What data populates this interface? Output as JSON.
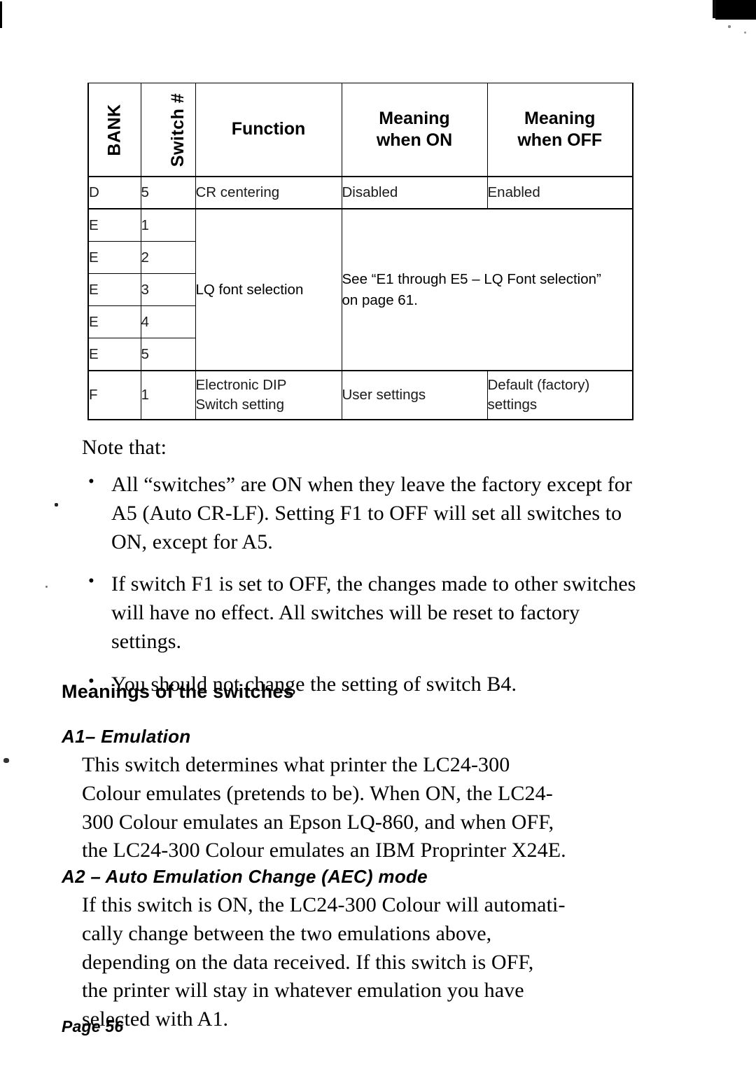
{
  "page": {
    "footer_label": "Page 56"
  },
  "table": {
    "headers": {
      "bank": "BANK",
      "switch_num": "Switch #",
      "function": "Function",
      "meaning_on_line1": "Meaning",
      "meaning_on_line2": "when ON",
      "meaning_off_line1": "Meaning",
      "meaning_off_line2": "when OFF"
    },
    "rows": [
      {
        "bank": "D",
        "switch": "5",
        "function": "CR centering",
        "on": "Disabled",
        "off": "Enabled"
      },
      {
        "bank": "E",
        "switch": "1"
      },
      {
        "bank": "E",
        "switch": "2"
      },
      {
        "bank": "E",
        "switch": "3"
      },
      {
        "bank": "E",
        "switch": "4"
      },
      {
        "bank": "E",
        "switch": "5"
      },
      {
        "bank": "F",
        "switch": "1",
        "function_line1": "Electronic DIP",
        "function_line2": "Switch setting",
        "on": "User settings",
        "off_line1": "Default (factory)",
        "off_line2": "settings"
      }
    ],
    "merged": {
      "lq_function": "LQ font selection",
      "lq_note_line1": "See “E1 through E5 – LQ Font selection”",
      "lq_note_line2": "on page 61."
    }
  },
  "note": {
    "lead": "Note that:",
    "bullets": [
      "All “switches” are ON when they leave the factory except for A5 (Auto CR-LF). Setting F1 to OFF will set all switches to ON, except for A5.",
      "If switch F1 is set to OFF, the changes made to other switches will have no effect. All switches will be reset to factory settings.",
      "You should not change the setting of switch B4."
    ]
  },
  "sections": {
    "heading": "Meanings of the switches",
    "a1": {
      "title": "A1– Emulation",
      "line1": "This switch determines what printer the LC24-300",
      "line2": "Colour emulates (pretends to be). When ON, the LC24-",
      "line3": "300 Colour emulates an Epson LQ-860, and when OFF,",
      "line4": "the LC24-300 Colour emulates an IBM Proprinter X24E."
    },
    "a2": {
      "title": "A2 – Auto Emulation Change (AEC) mode",
      "line1": "If this switch is ON, the LC24-300 Colour will automati-",
      "line2": "cally change between the two emulations above,",
      "line3": "depending on the data received. If this switch is OFF,",
      "line4": "the printer will stay in whatever emulation you have",
      "line5": "selected with A1."
    }
  }
}
